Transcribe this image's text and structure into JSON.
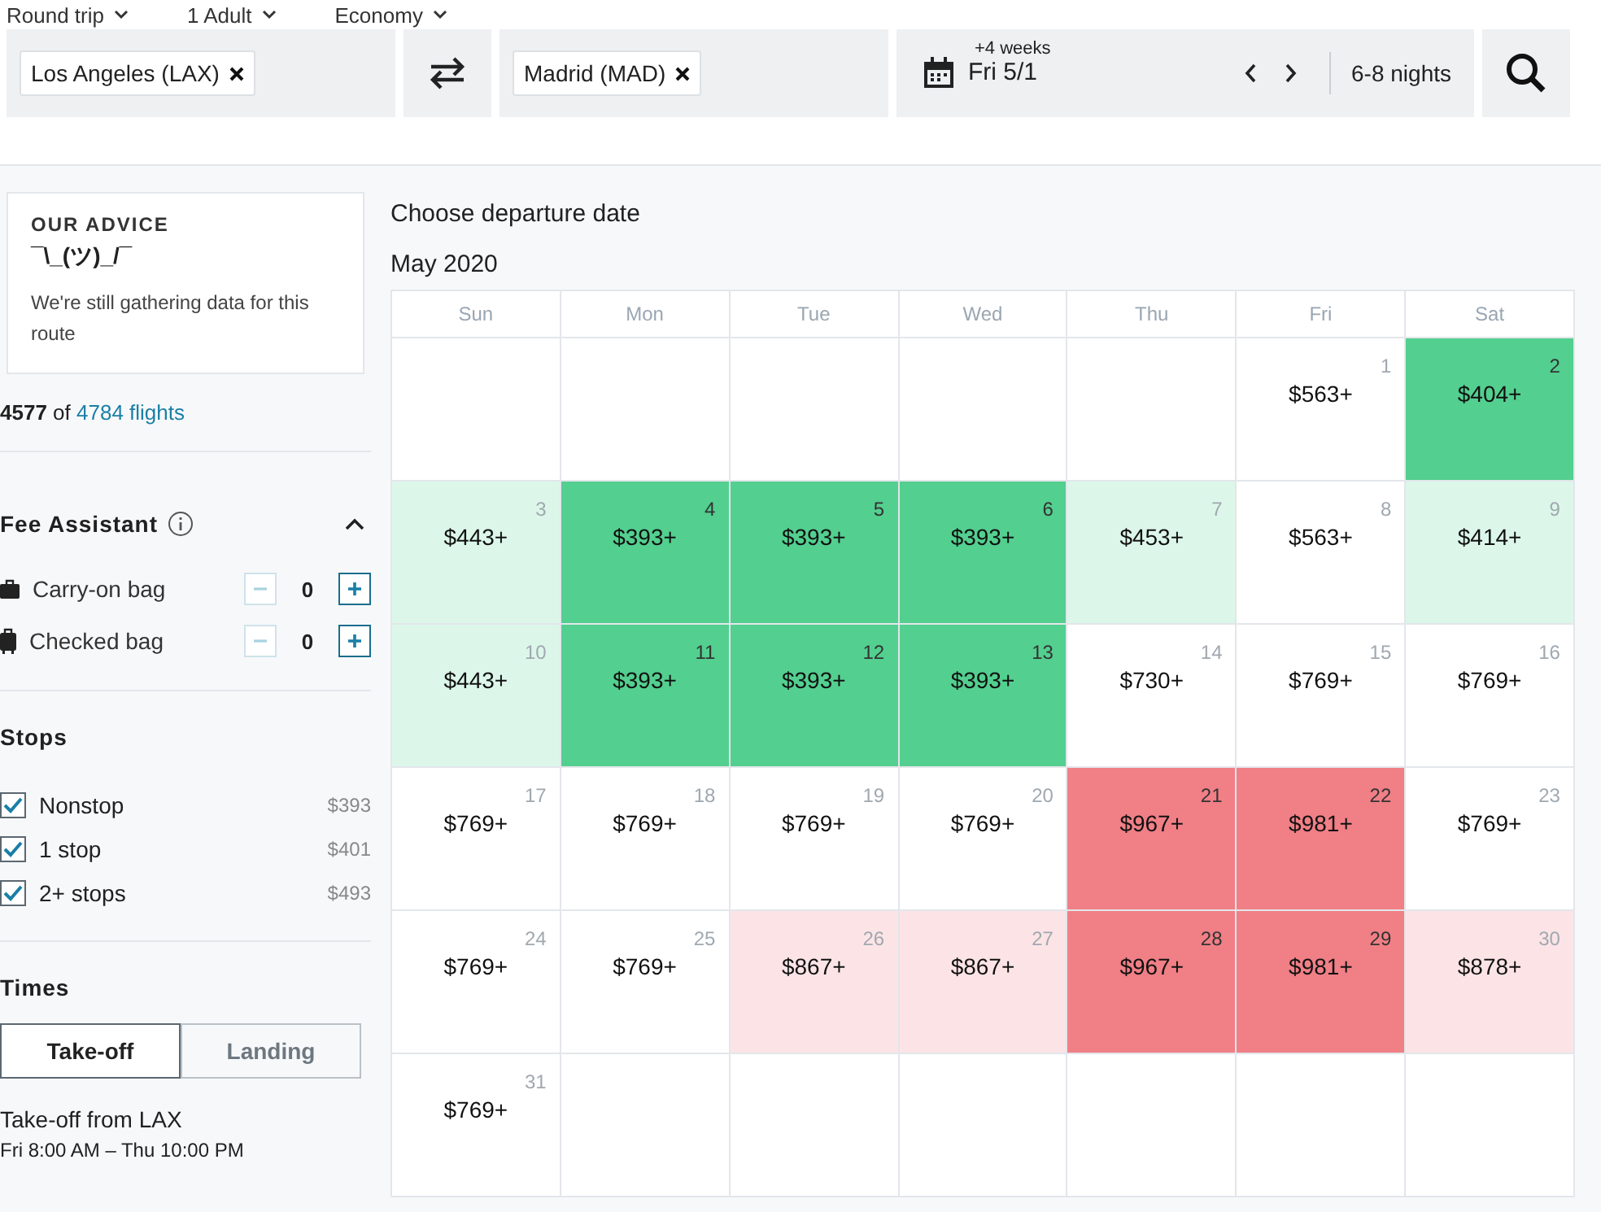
{
  "trip_options": [
    {
      "label": "Round trip"
    },
    {
      "label": "1 Adult"
    },
    {
      "label": "Economy"
    }
  ],
  "search": {
    "origin": "Los Angeles (LAX)",
    "destination": "Madrid (MAD)",
    "date_offset": "+4 weeks",
    "date": "Fri 5/1",
    "nights": "6-8 nights"
  },
  "advice": {
    "title": "OUR ADVICE",
    "shrug": "¯\\_(ツ)_/¯",
    "text": "We're still gathering data for this route"
  },
  "flight_count": {
    "shown": "4577",
    "of": "of",
    "total": "4784 flights"
  },
  "fee_assistant": {
    "title": "Fee Assistant",
    "expanded": true,
    "bags": [
      {
        "label": "Carry-on bag",
        "count": "0",
        "kind": "carry-on"
      },
      {
        "label": "Checked bag",
        "count": "0",
        "kind": "checked"
      }
    ]
  },
  "stops": {
    "title": "Stops",
    "options": [
      {
        "label": "Nonstop",
        "price": "$393",
        "checked": true
      },
      {
        "label": "1 stop",
        "price": "$401",
        "checked": true
      },
      {
        "label": "2+ stops",
        "price": "$493",
        "checked": true
      }
    ]
  },
  "times": {
    "title": "Times",
    "tabs": [
      {
        "label": "Take-off",
        "selected": true
      },
      {
        "label": "Landing",
        "selected": false
      }
    ],
    "caption": "Take-off from LAX",
    "range": "Fri 8:00 AM – Thu 10:00 PM"
  },
  "calendar": {
    "title": "Choose departure date",
    "month": "May 2020",
    "weekdays": [
      "Sun",
      "Mon",
      "Tue",
      "Wed",
      "Thu",
      "Fri",
      "Sat"
    ],
    "weeks": [
      [
        {
          "kind": "empty"
        },
        {
          "kind": "empty"
        },
        {
          "kind": "empty"
        },
        {
          "kind": "empty"
        },
        {
          "kind": "empty"
        },
        {
          "day": "1",
          "price": "$563+",
          "color": "#ffffff"
        },
        {
          "day": "2",
          "price": "$404+",
          "color": "#53cf8f"
        }
      ],
      [
        {
          "day": "3",
          "price": "$443+",
          "color": "#dcf7ea"
        },
        {
          "day": "4",
          "price": "$393+",
          "color": "#53cf8f"
        },
        {
          "day": "5",
          "price": "$393+",
          "color": "#53cf8f"
        },
        {
          "day": "6",
          "price": "$393+",
          "color": "#53cf8f"
        },
        {
          "day": "7",
          "price": "$453+",
          "color": "#dcf7ea"
        },
        {
          "day": "8",
          "price": "$563+",
          "color": "#ffffff"
        },
        {
          "day": "9",
          "price": "$414+",
          "color": "#dcf7ea"
        }
      ],
      [
        {
          "day": "10",
          "price": "$443+",
          "color": "#dcf7ea"
        },
        {
          "day": "11",
          "price": "$393+",
          "color": "#53cf8f"
        },
        {
          "day": "12",
          "price": "$393+",
          "color": "#53cf8f"
        },
        {
          "day": "13",
          "price": "$393+",
          "color": "#53cf8f"
        },
        {
          "day": "14",
          "price": "$730+",
          "color": "#ffffff"
        },
        {
          "day": "15",
          "price": "$769+",
          "color": "#ffffff"
        },
        {
          "day": "16",
          "price": "$769+",
          "color": "#ffffff"
        }
      ],
      [
        {
          "day": "17",
          "price": "$769+",
          "color": "#ffffff"
        },
        {
          "day": "18",
          "price": "$769+",
          "color": "#ffffff"
        },
        {
          "day": "19",
          "price": "$769+",
          "color": "#ffffff"
        },
        {
          "day": "20",
          "price": "$769+",
          "color": "#ffffff"
        },
        {
          "day": "21",
          "price": "$967+",
          "color": "#f07f86"
        },
        {
          "day": "22",
          "price": "$981+",
          "color": "#f07f86"
        },
        {
          "day": "23",
          "price": "$769+",
          "color": "#ffffff"
        }
      ],
      [
        {
          "day": "24",
          "price": "$769+",
          "color": "#ffffff"
        },
        {
          "day": "25",
          "price": "$769+",
          "color": "#ffffff"
        },
        {
          "day": "26",
          "price": "$867+",
          "color": "#fce4e6"
        },
        {
          "day": "27",
          "price": "$867+",
          "color": "#fce4e6"
        },
        {
          "day": "28",
          "price": "$967+",
          "color": "#f07f86"
        },
        {
          "day": "29",
          "price": "$981+",
          "color": "#f07f86"
        },
        {
          "day": "30",
          "price": "$878+",
          "color": "#fce4e6"
        }
      ],
      [
        {
          "day": "31",
          "price": "$769+",
          "color": "#ffffff"
        },
        {
          "kind": "empty"
        },
        {
          "kind": "empty"
        },
        {
          "kind": "empty"
        },
        {
          "kind": "empty"
        },
        {
          "kind": "empty"
        },
        {
          "kind": "empty"
        }
      ]
    ]
  }
}
